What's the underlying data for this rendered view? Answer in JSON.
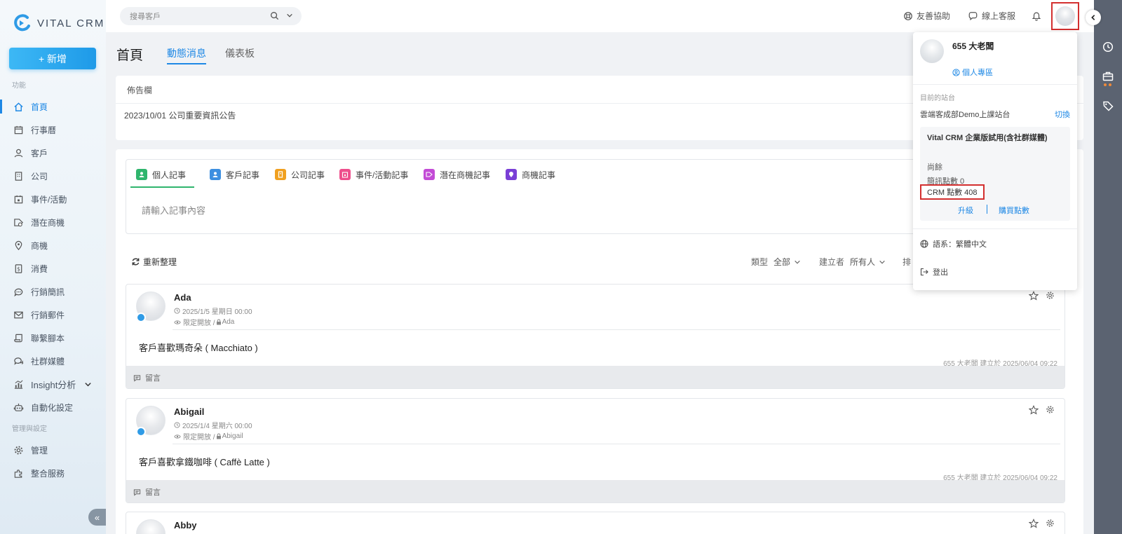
{
  "brand": {
    "name": "VITAL CRM",
    "accent": "#1e88e5"
  },
  "sidebar": {
    "new_button": "+ 新增",
    "section_function": "功能",
    "section_admin": "管理與設定",
    "items": [
      {
        "label": "首頁",
        "icon": "home-icon"
      },
      {
        "label": "行事曆",
        "icon": "calendar-icon"
      },
      {
        "label": "客戶",
        "icon": "user-icon"
      },
      {
        "label": "公司",
        "icon": "building-icon"
      },
      {
        "label": "事件/活動",
        "icon": "event-icon"
      },
      {
        "label": "潛在商機",
        "icon": "tag-icon"
      },
      {
        "label": "商機",
        "icon": "pin-icon"
      },
      {
        "label": "消費",
        "icon": "receipt-icon"
      },
      {
        "label": "行銷簡訊",
        "icon": "sms-icon"
      },
      {
        "label": "行銷郵件",
        "icon": "mail-icon"
      },
      {
        "label": "聯繫腳本",
        "icon": "script-icon"
      },
      {
        "label": "社群媒體",
        "icon": "chat-icon"
      },
      {
        "label": "Insight分析",
        "icon": "chart-icon"
      },
      {
        "label": "自動化設定",
        "icon": "robot-icon"
      }
    ],
    "admin_items": [
      {
        "label": "管理",
        "icon": "gear-icon"
      },
      {
        "label": "整合服務",
        "icon": "puzzle-icon"
      }
    ]
  },
  "topbar": {
    "search_placeholder": "搜尋客戶",
    "help_label": "友善協助",
    "support_label": "線上客服"
  },
  "page": {
    "title": "首頁",
    "tabs": [
      "動態消息",
      "儀表板"
    ]
  },
  "announcement": {
    "header": "佈告欄",
    "item": "2023/10/01 公司重要資訊公告"
  },
  "editor": {
    "tabs": [
      {
        "label": "個人記事",
        "color": "#2fb56d"
      },
      {
        "label": "客戶記事",
        "color": "#3d8fe0"
      },
      {
        "label": "公司記事",
        "color": "#f0a020"
      },
      {
        "label": "事件/活動記事",
        "color": "#ee4e8c"
      },
      {
        "label": "潛在商機記事",
        "color": "#c34bd6"
      },
      {
        "label": "商機記事",
        "color": "#7a3fd6"
      }
    ],
    "placeholder": "請輸入記事內容"
  },
  "feed": {
    "refresh_label": "重新整理",
    "filter_type_label": "類型",
    "filter_type_value": "全部",
    "filter_creator_label": "建立者",
    "filter_creator_value": "所有人",
    "sort_label": "排",
    "comment_label": "留言",
    "posts": [
      {
        "name": "Ada",
        "date": "2025/1/5 星期日 00:00",
        "visibility": "限定開放 / ",
        "owner": "Ada",
        "content": "客戶喜歡瑪奇朵 ( Macchiato )",
        "meta": "655 大老闆 建立於 2025/06/04 09:22"
      },
      {
        "name": "Abigail",
        "date": "2025/1/4 星期六 00:00",
        "visibility": "限定開放 / ",
        "owner": "Abigail",
        "content": "客戶喜歡拿鐵咖啡 ( Caffè Latte )",
        "meta": "655 大老闆 建立於 2025/06/04 09:22"
      },
      {
        "name": "Abby"
      }
    ]
  },
  "user_menu": {
    "name": "655 大老闆",
    "profile_link": "個人專區",
    "current_site_label": "目前的站台",
    "site_name": "雲端客成部Demo上課站台",
    "switch_label": "切換",
    "plan_title": "Vital CRM 企業版試用(含社群媒體)",
    "remaining_label": "尚餘",
    "sms_points": "簡訊點數 0",
    "crm_points": "CRM 點數 408",
    "upgrade_label": "升級",
    "buy_points_label": "購買點數",
    "language_label": "語系：繁體中文",
    "logout_label": "登出"
  }
}
